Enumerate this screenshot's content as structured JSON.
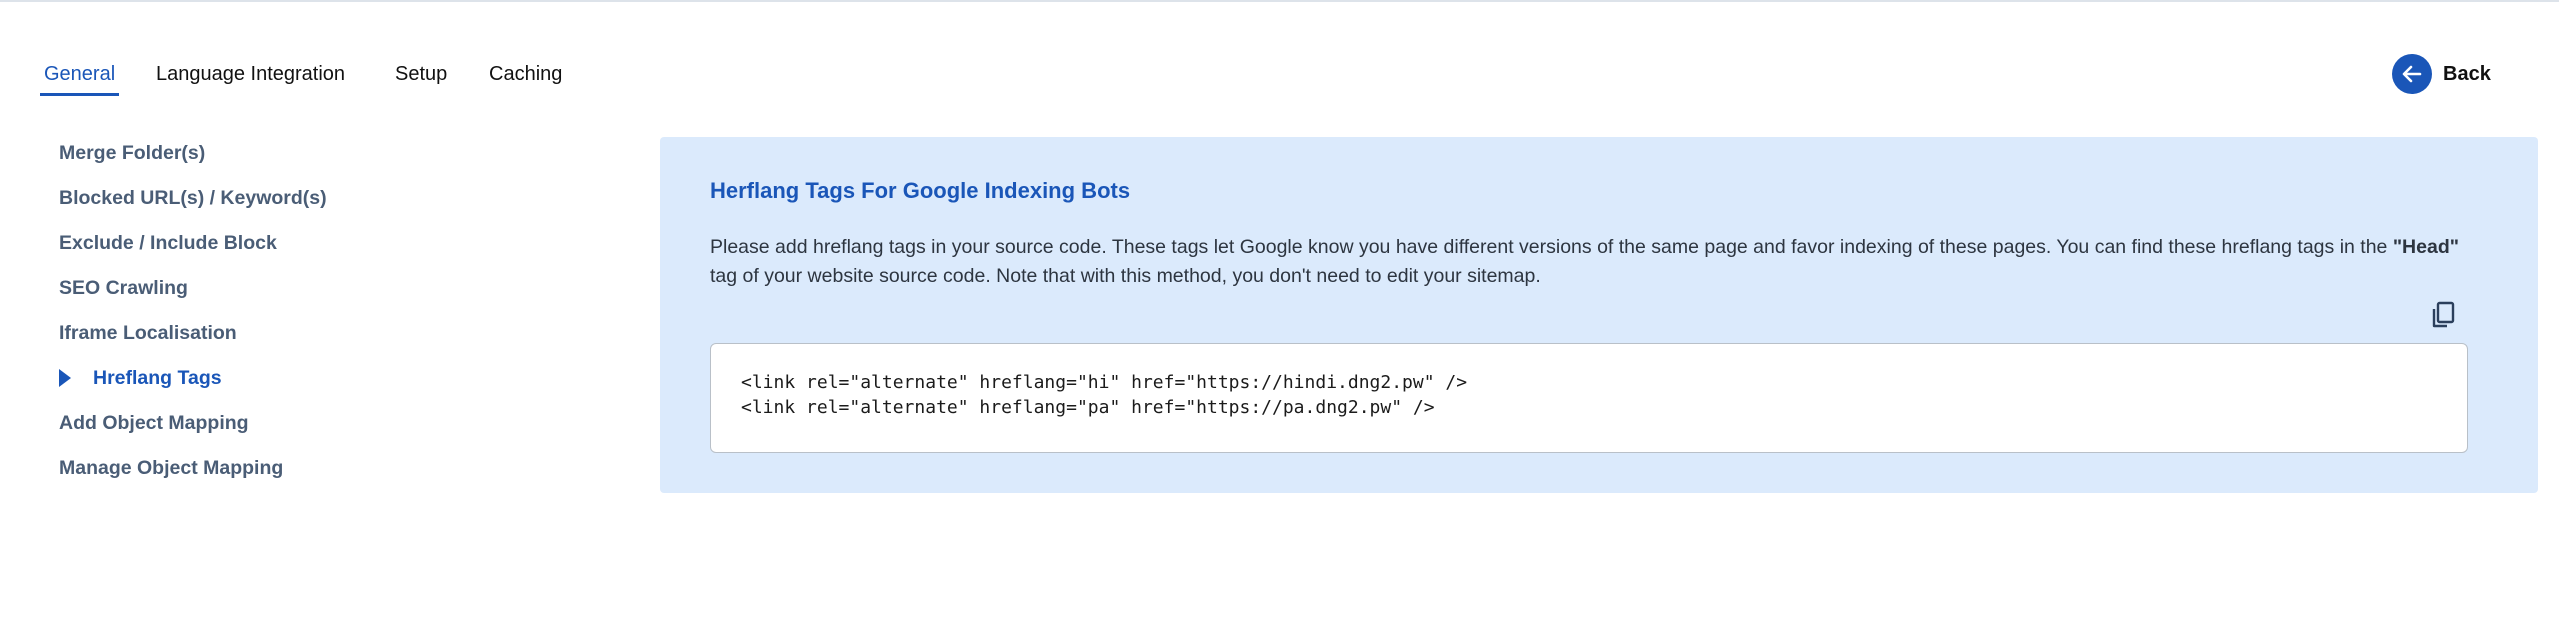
{
  "tabs": [
    {
      "label": "General",
      "active": true
    },
    {
      "label": "Language Integration",
      "active": false
    },
    {
      "label": "Setup",
      "active": false
    },
    {
      "label": "Caching",
      "active": false
    }
  ],
  "back": {
    "label": "Back",
    "icon": "arrow-left-icon"
  },
  "sidebar": {
    "items": [
      {
        "label": "Merge Folder(s)",
        "active": false
      },
      {
        "label": "Blocked URL(s) / Keyword(s)",
        "active": false
      },
      {
        "label": "Exclude / Include Block",
        "active": false
      },
      {
        "label": "SEO Crawling",
        "active": false
      },
      {
        "label": "Iframe Localisation",
        "active": false
      },
      {
        "label": "Hreflang Tags",
        "active": true
      },
      {
        "label": "Add Object Mapping",
        "active": false
      },
      {
        "label": "Manage Object Mapping",
        "active": false
      }
    ]
  },
  "panel": {
    "title": "Herflang Tags For Google Indexing Bots",
    "desc_part1": "Please add hreflang tags in your source code. These tags let Google know you have different versions of the same page and favor indexing of these pages. You can find these hreflang tags in the ",
    "desc_bold": "\"Head\"",
    "desc_part2": " tag of your website source code. Note that with this method, you don't need to edit your sitemap.",
    "copy_icon": "copy-icon",
    "code_lines": [
      "<link rel=\"alternate\" hreflang=\"hi\" href=\"https://hindi.dng2.pw\" />",
      "<link rel=\"alternate\" hreflang=\"pa\" href=\"https://pa.dng2.pw\" />"
    ]
  },
  "colors": {
    "accent": "#1a56b8",
    "panel_bg": "#dbeafc",
    "sidebar_text": "#4a5d76"
  }
}
